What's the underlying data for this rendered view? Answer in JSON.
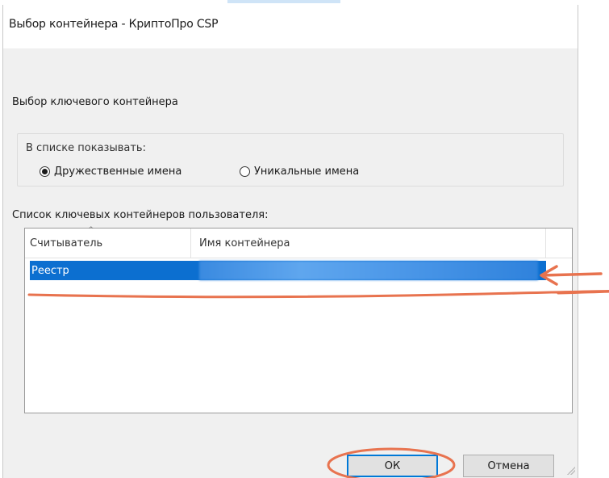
{
  "window": {
    "title": "Выбор контейнера - КриптоПро CSP"
  },
  "dialog": {
    "heading": "Выбор ключевого контейнера",
    "show_group": {
      "legend": "В списке показывать:",
      "options": [
        {
          "label": "Дружественные имена",
          "selected": true
        },
        {
          "label": "Уникальные имена",
          "selected": false
        }
      ]
    },
    "list": {
      "label": "Список ключевых контейнеров пользователя:",
      "columns": [
        "Считыватель",
        "Имя контейнера"
      ],
      "rows": [
        {
          "reader": "Реестр",
          "container": "",
          "selected": true
        }
      ]
    },
    "buttons": {
      "ok": "ОК",
      "cancel": "Отмена"
    }
  },
  "colors": {
    "selection": "#0c6fd0",
    "annotation": "#e8734f",
    "background": "#f0f0f0",
    "focus": "#0078d7"
  },
  "icons": {
    "sort": "sort-arrow-icon",
    "grip": "resize-grip-icon"
  }
}
